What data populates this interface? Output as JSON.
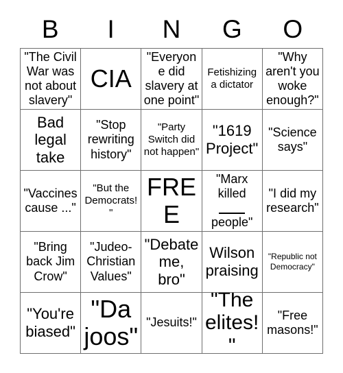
{
  "header": {
    "letters": [
      "B",
      "I",
      "N",
      "G",
      "O"
    ]
  },
  "grid": {
    "rows": 5,
    "columns": 5,
    "border_color": "#6e6e6e",
    "background_color": "#ffffff",
    "text_color": "#000000",
    "cells": [
      {
        "text": "\"The Civil War was not about slavery\"",
        "size": "md"
      },
      {
        "text": "CIA",
        "size": "xxl"
      },
      {
        "text": "\"Everyone did slavery at one point\"",
        "size": "md"
      },
      {
        "text": "Fetishizing a dictator",
        "size": "sm"
      },
      {
        "text": "\"Why aren't you woke enough?\"",
        "size": "md"
      },
      {
        "text": "Bad legal take",
        "size": "lg"
      },
      {
        "text": "\"Stop rewriting history\"",
        "size": "md"
      },
      {
        "text": "\"Party Switch did not happen\"",
        "size": "sm"
      },
      {
        "text": "\"1619 Project\"",
        "size": "lg"
      },
      {
        "text": "\"Science says\"",
        "size": "md"
      },
      {
        "text": "\"Vaccines cause ...\"",
        "size": "md"
      },
      {
        "text": "\"But the Democrats!\"",
        "size": "sm"
      },
      {
        "text": "FREE",
        "size": "xxl"
      },
      {
        "text": "\"Marx killed ___ people\"",
        "size": "md",
        "blank": true,
        "blank_before": "\"Marx killed",
        "blank_after": "people\""
      },
      {
        "text": "\"I did my research\"",
        "size": "md"
      },
      {
        "text": "\"Bring back Jim Crow\"",
        "size": "md"
      },
      {
        "text": "\"Judeo-Christian Values\"",
        "size": "md"
      },
      {
        "text": "\"Debate me, bro\"",
        "size": "lg"
      },
      {
        "text": "Wilson praising",
        "size": "lg"
      },
      {
        "text": "\"Republic not Democracy\"",
        "size": "xs"
      },
      {
        "text": "\"You're biased\"",
        "size": "lg"
      },
      {
        "text": "\"Da joos\"",
        "size": "xxl"
      },
      {
        "text": "\"Jesuits!\"",
        "size": "md"
      },
      {
        "text": "\"The elites!\"",
        "size": "xl"
      },
      {
        "text": "\"Free masons!\"",
        "size": "md"
      }
    ]
  }
}
